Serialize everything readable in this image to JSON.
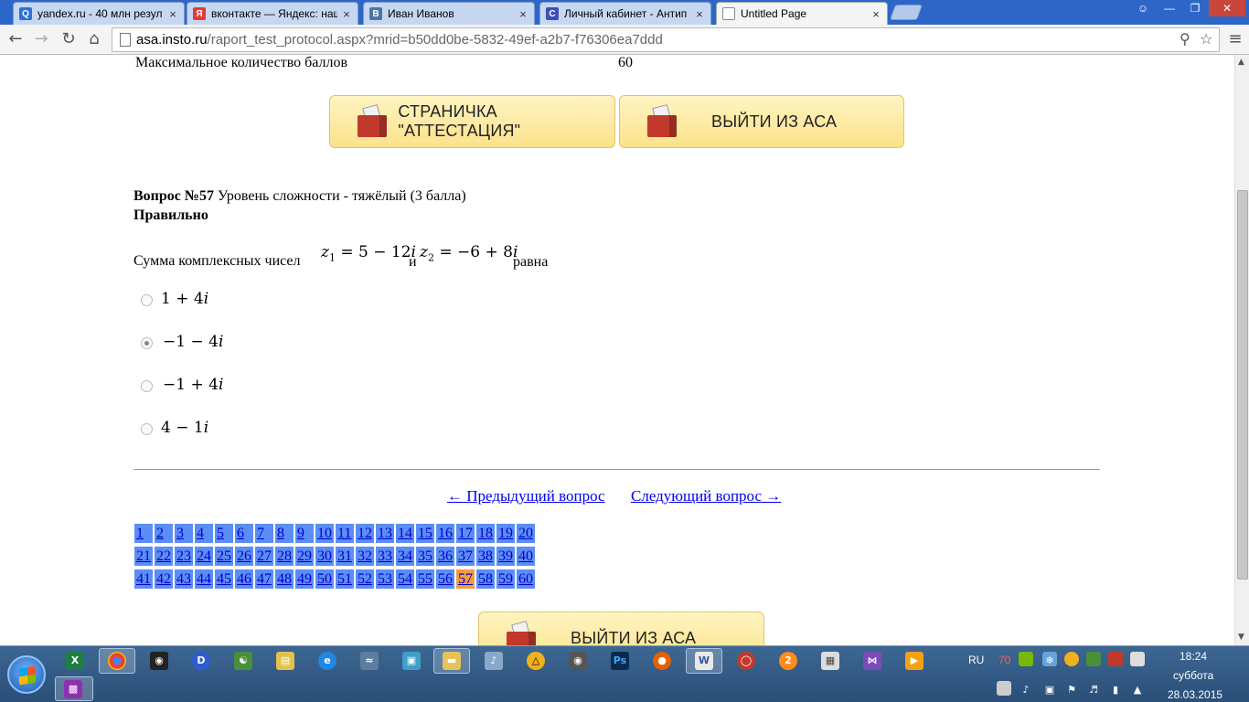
{
  "browser": {
    "tabs": [
      {
        "label": "yandex.ru - 40 млн резул",
        "icon": "yandex-search-icon",
        "color": "#2f6fd6",
        "glyph": "Q"
      },
      {
        "label": "вконтакте — Яндекс: наш",
        "icon": "yandex-icon",
        "color": "#e53935",
        "glyph": "Я"
      },
      {
        "label": "Иван Иванов",
        "icon": "vk-icon",
        "color": "#4a76a8",
        "glyph": "В"
      },
      {
        "label": "Личный кабинет - Антип",
        "icon": "antiplagiat-icon",
        "color": "#3b4fb8",
        "glyph": "C"
      },
      {
        "label": "Untitled Page",
        "icon": "page-icon",
        "color": "#ffffff",
        "glyph": ""
      }
    ],
    "close_glyph": "×",
    "url_host": "asa.insto.ru",
    "url_path": "/raport_test_protocol.aspx?mrid=b50dd0be-5832-49ef-a2b7-f76306ea7ddd"
  },
  "page": {
    "max_score_label": "Максимальное количество баллов",
    "max_score_value": "60",
    "buttons": {
      "attestation": "СТРАНИЧКА \"АТТЕСТАЦИЯ\"",
      "exit_top": "ВЫЙТИ ИЗ АСА",
      "exit_bottom": "ВЫЙТИ ИЗ АСА"
    },
    "question": {
      "number_label": "Вопрос №57",
      "difficulty": " Уровень сложности - тяжёлый (3 балла)",
      "status": "Правильно",
      "text_before": "Сумма комплексных чисел",
      "z1": "5 − 12",
      "conj": "и",
      "z2": "−6 + 8",
      "text_after": "равна",
      "options": [
        {
          "a": "1 + 4",
          "i": "i",
          "checked": false
        },
        {
          "a": "−1 − 4",
          "i": "i",
          "checked": true
        },
        {
          "a": "−1 + 4",
          "i": "i",
          "checked": false
        },
        {
          "a": "4 − 1",
          "i": "i",
          "checked": false
        }
      ]
    },
    "nav": {
      "prev": "← Предыдущий вопрос",
      "next": "Следующий вопрос →"
    },
    "question_grid": {
      "total": 60,
      "current": 57
    }
  },
  "taskbar": {
    "lang": "RU",
    "tray_number": "70",
    "time": "18:24",
    "day": "суббота",
    "date": "28.03.2015"
  },
  "colors": {
    "grid_cell": "#5b8df5",
    "grid_current": "#f49b3c",
    "link": "#0000ee"
  }
}
